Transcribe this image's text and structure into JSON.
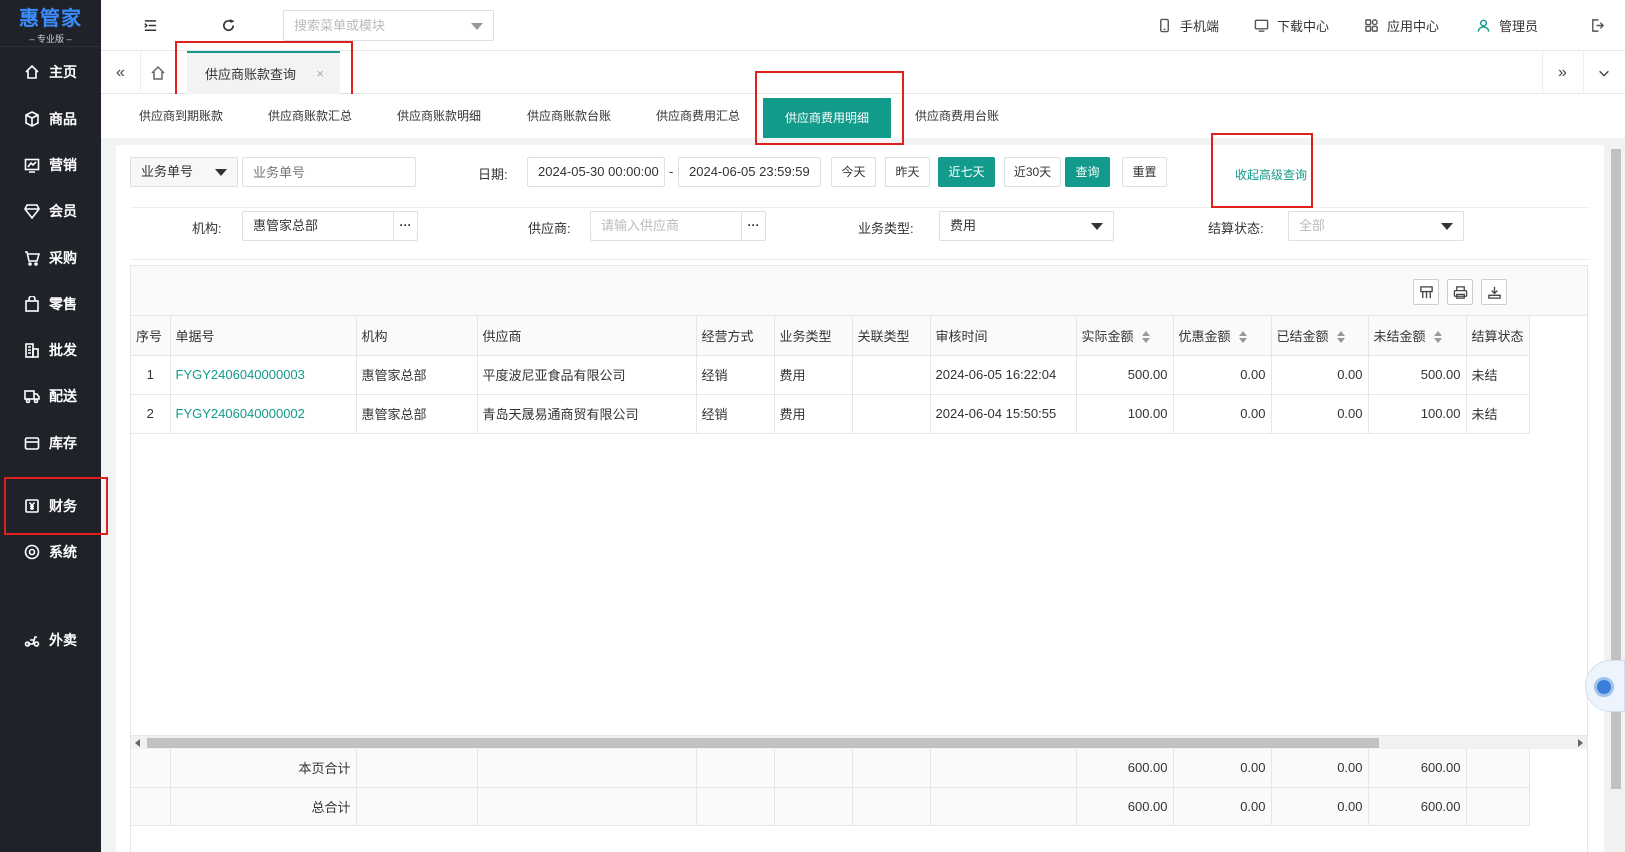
{
  "app": {
    "logo_main": "惠管家",
    "logo_sub": "– 专业版 –"
  },
  "sidebar": {
    "items": [
      {
        "label": "主页",
        "icon": "home-icon"
      },
      {
        "label": "商品",
        "icon": "box-icon"
      },
      {
        "label": "营销",
        "icon": "chart-icon"
      },
      {
        "label": "会员",
        "icon": "diamond-icon"
      },
      {
        "label": "采购",
        "icon": "cart-icon"
      },
      {
        "label": "零售",
        "icon": "bag-icon"
      },
      {
        "label": "批发",
        "icon": "building-icon"
      },
      {
        "label": "配送",
        "icon": "truck-icon"
      },
      {
        "label": "库存",
        "icon": "warehouse-icon"
      },
      {
        "label": "财务",
        "icon": "yuan-icon"
      },
      {
        "label": "系统",
        "icon": "settings-icon"
      },
      {
        "label": "外卖",
        "icon": "scooter-icon"
      }
    ]
  },
  "topbar": {
    "search_placeholder": "搜索菜单或模块",
    "mobile": "手机端",
    "download": "下载中心",
    "apps": "应用中心",
    "user": "管理员"
  },
  "tabs": {
    "open_tab": "供应商账款查询",
    "close": "×"
  },
  "subtabs": [
    "供应商到期账款",
    "供应商账款汇总",
    "供应商账款明细",
    "供应商账款台账",
    "供应商费用汇总",
    "供应商费用明细",
    "供应商费用台账"
  ],
  "filters": {
    "field_select": "业务单号",
    "field_placeholder": "业务单号",
    "date_label": "日期:",
    "date_start": "2024-05-30 00:00:00",
    "date_sep": "-",
    "date_end": "2024-06-05 23:59:59",
    "btn_today": "今天",
    "btn_yesterday": "昨天",
    "btn_7days": "近七天",
    "btn_30days": "近30天",
    "btn_query": "查询",
    "btn_reset": "重置",
    "advanced_link": "收起高级查询",
    "org_label": "机构:",
    "org_value": "惠管家总部",
    "supplier_label": "供应商:",
    "supplier_placeholder": "请输入供应商",
    "biz_type_label": "业务类型:",
    "biz_type_value": "费用",
    "settle_label": "结算状态:",
    "settle_value": "全部",
    "dots": "···"
  },
  "table": {
    "headers": [
      "序号",
      "单据号",
      "机构",
      "供应商",
      "经营方式",
      "业务类型",
      "关联类型",
      "审核时间",
      "实际金额",
      "优惠金额",
      "已结金额",
      "未结金额",
      "结算状态"
    ],
    "rows": [
      [
        "1",
        "FYGY2406040000003",
        "惠管家总部",
        "平度波尼亚食品有限公司",
        "经销",
        "费用",
        "",
        "2024-06-05 16:22:04",
        "500.00",
        "0.00",
        "0.00",
        "500.00",
        "未结"
      ],
      [
        "2",
        "FYGY2406040000002",
        "惠管家总部",
        "青岛天晟易通商贸有限公司",
        "经销",
        "费用",
        "",
        "2024-06-04 15:50:55",
        "100.00",
        "0.00",
        "0.00",
        "100.00",
        "未结"
      ]
    ],
    "page_total_label": "本页合计",
    "page_total": [
      "600.00",
      "0.00",
      "0.00",
      "600.00"
    ],
    "grand_total_label": "总合计",
    "grand_total": [
      "600.00",
      "0.00",
      "0.00",
      "600.00"
    ]
  },
  "colors": {
    "accent": "#129a8b",
    "sidebar_bg": "#1f2329",
    "highlight": "#e0201c"
  }
}
